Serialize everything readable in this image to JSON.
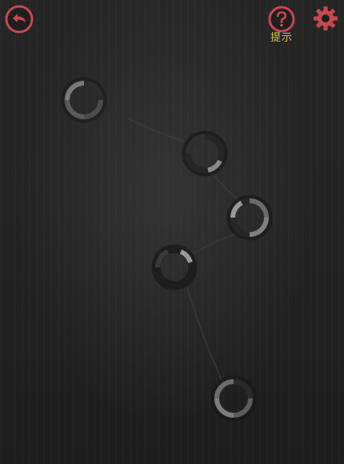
{
  "toolbar": {
    "back_icon": "undo-arrow-icon",
    "hint_icon": "question-mark-icon",
    "hint_label": "提示",
    "settings_icon": "gear-icon",
    "accent_color": "#c8484f",
    "hint_label_color": "#d8c64a"
  },
  "puzzle": {
    "node_count": 5,
    "link_count": 4,
    "ring_color_light": "#7a7a7a",
    "ring_color_dark": "#2c2c2c",
    "link_color": "#3a3a3a"
  }
}
